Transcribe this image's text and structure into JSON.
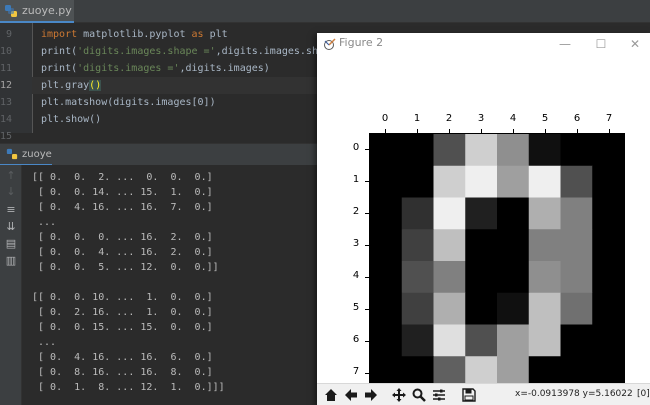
{
  "editor": {
    "tab_label": "zuoye.py",
    "file_icon": "python-file-icon",
    "lines": [
      {
        "num": "9",
        "segments": [
          {
            "t": "kw",
            "v": "import "
          },
          {
            "t": "plain",
            "v": "matplotlib.pyplot "
          },
          {
            "t": "kw",
            "v": "as "
          },
          {
            "t": "plain",
            "v": "plt"
          }
        ]
      },
      {
        "num": "10",
        "segments": [
          {
            "t": "plain",
            "v": "print("
          },
          {
            "t": "str",
            "v": "'digits.images.shape ='"
          },
          {
            "t": "plain",
            "v": ",digits.images.shape)"
          }
        ]
      },
      {
        "num": "11",
        "segments": [
          {
            "t": "plain",
            "v": "print("
          },
          {
            "t": "str",
            "v": "'digits.images ='"
          },
          {
            "t": "plain",
            "v": ",digits.images)"
          }
        ]
      },
      {
        "num": "12",
        "segments": [
          {
            "t": "plain",
            "v": "plt.gray"
          },
          {
            "t": "paren",
            "v": "()"
          }
        ]
      },
      {
        "num": "13",
        "segments": [
          {
            "t": "plain",
            "v": "plt.matshow(digits.images[0])"
          }
        ]
      },
      {
        "num": "14",
        "segments": [
          {
            "t": "plain",
            "v": "plt.show()"
          }
        ]
      },
      {
        "num": "15",
        "segments": []
      }
    ],
    "current_line": "12"
  },
  "run_panel": {
    "tab_label": "zuoye",
    "tab_icon": "python-run-icon",
    "toolbar_icons": [
      "rerun-icon",
      "stop-icon",
      "soft-wrap-icon",
      "scroll-to-end-icon",
      "print-icon",
      "clear-icon"
    ],
    "console_lines": [
      "[[ 0.  0.  2. ...  0.  0.  0.]",
      " [ 0.  0. 14. ... 15.  1.  0.]",
      " [ 0.  4. 16. ... 16.  7.  0.]",
      " ...",
      " [ 0.  0.  0. ... 16.  2.  0.]",
      " [ 0.  0.  4. ... 16.  2.  0.]",
      " [ 0.  0.  5. ... 12.  0.  0.]]",
      "",
      "[[ 0.  0. 10. ...  1.  0.  0.]",
      " [ 0.  2. 16. ...  1.  0.  0.]",
      " [ 0.  0. 15. ... 15.  0.  0.]",
      " ...",
      " [ 0.  4. 16. ... 16.  6.  0.]",
      " [ 0.  8. 16. ... 16.  8.  0.]",
      " [ 0.  1.  8. ... 12.  1.  0.]]]"
    ]
  },
  "figure": {
    "title": "Figure 2",
    "window_icon": "matplotlib-icon",
    "minimize_label": "—",
    "maximize_label": "☐",
    "close_label": "✕",
    "x_ticks": [
      "0",
      "1",
      "2",
      "3",
      "4",
      "5",
      "6",
      "7"
    ],
    "y_ticks": [
      "0",
      "1",
      "2",
      "3",
      "4",
      "5",
      "6",
      "7"
    ],
    "toolbar_icons": [
      "home-icon",
      "back-icon",
      "forward-icon",
      "pan-icon",
      "zoom-icon",
      "configure-subplots-icon",
      "save-icon"
    ],
    "coord_readout": "x=-0.0913978   y=5.16022",
    "coord_bracket": "[0]"
  },
  "chart_data": {
    "type": "heatmap",
    "colormap": "gray",
    "x_ticks": [
      0,
      1,
      2,
      3,
      4,
      5,
      6,
      7
    ],
    "y_ticks": [
      0,
      1,
      2,
      3,
      4,
      5,
      6,
      7
    ],
    "vmin": 0,
    "vmax": 16,
    "values": [
      [
        0,
        0,
        5,
        13,
        9,
        1,
        0,
        0
      ],
      [
        0,
        0,
        13,
        15,
        10,
        15,
        5,
        0
      ],
      [
        0,
        3,
        15,
        2,
        0,
        11,
        8,
        0
      ],
      [
        0,
        4,
        12,
        0,
        0,
        8,
        8,
        0
      ],
      [
        0,
        5,
        8,
        0,
        0,
        9,
        8,
        0
      ],
      [
        0,
        4,
        11,
        0,
        1,
        12,
        7,
        0
      ],
      [
        0,
        2,
        14,
        5,
        10,
        12,
        0,
        0
      ],
      [
        0,
        0,
        6,
        13,
        10,
        0,
        0,
        0
      ]
    ]
  }
}
